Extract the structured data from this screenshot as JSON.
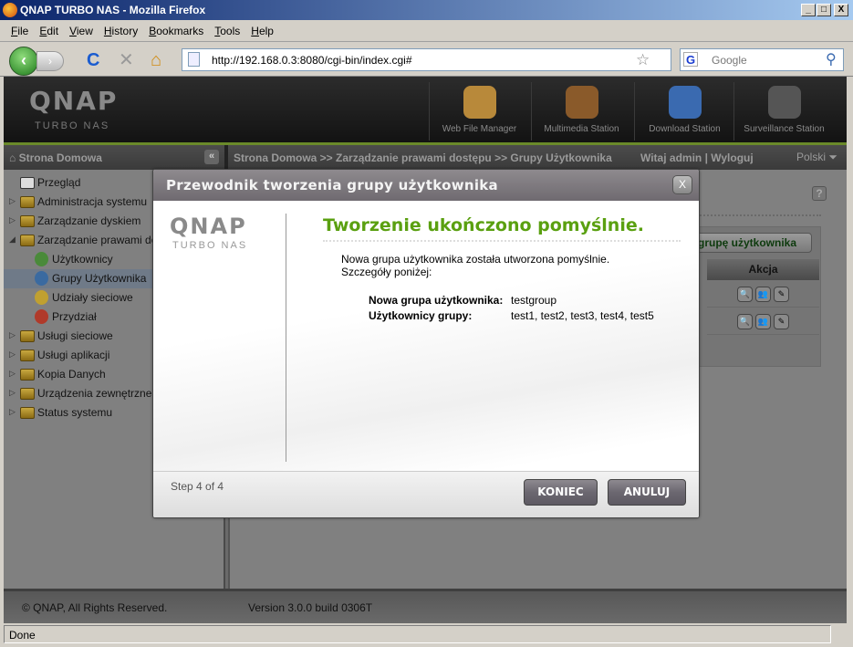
{
  "window": {
    "title": "QNAP TURBO NAS - Mozilla Firefox",
    "minimize": "_",
    "maximize": "□",
    "close": "X"
  },
  "menu": [
    "File",
    "Edit",
    "View",
    "History",
    "Bookmarks",
    "Tools",
    "Help"
  ],
  "nav": {
    "url": "http://192.168.0.3:8080/cgi-bin/index.cgi#",
    "search_placeholder": "Google",
    "back": "‹",
    "forward": "›",
    "reload": "C",
    "stop": "✕",
    "home": "⌂",
    "star": "☆",
    "search_go": "⚲",
    "google_icon": "G"
  },
  "header": {
    "logo": "QNAP",
    "logo_sub": "TURBO NAS",
    "apps": [
      {
        "label": "Web File Manager",
        "color": "#b8893a"
      },
      {
        "label": "Multimedia Station",
        "color": "#8a5a2a"
      },
      {
        "label": "Download Station",
        "color": "#3a6ab0"
      },
      {
        "label": "Surveillance Station",
        "color": "#555555"
      }
    ]
  },
  "crumbbar": {
    "home": "Strona Domowa",
    "collapse": "«",
    "path": "Strona Domowa >> Zarządzanie prawami dostępu >> Grupy Użytkownika",
    "welcome": "Witaj admin | Wyloguj",
    "language": "Polski ⏷"
  },
  "sidebar": {
    "items": [
      {
        "label": "Przegląd",
        "type": "root-noarrow"
      },
      {
        "label": "Administracja systemu",
        "type": "folder"
      },
      {
        "label": "Zarządzanie dyskiem",
        "type": "folder"
      },
      {
        "label": "Zarządzanie prawami dostępu",
        "type": "folder-open"
      },
      {
        "label": "Użytkownicy",
        "type": "sub",
        "icon_color": "#4a8a3a"
      },
      {
        "label": "Grupy Użytkownika",
        "type": "sub",
        "icon_color": "#3a6aa0",
        "selected": true
      },
      {
        "label": "Udziały sieciowe",
        "type": "sub",
        "icon_color": "#c0a030"
      },
      {
        "label": "Przydział",
        "type": "sub",
        "icon_color": "#b03a2a"
      },
      {
        "label": "Usługi sieciowe",
        "type": "folder"
      },
      {
        "label": "Usługi aplikacji",
        "type": "folder"
      },
      {
        "label": "Kopia Danych",
        "type": "folder"
      },
      {
        "label": "Urządzenia zewnętrzne",
        "type": "folder"
      },
      {
        "label": "Status systemu",
        "type": "folder"
      }
    ]
  },
  "content": {
    "help": "?",
    "add_button": "grupę użytkownika",
    "column_action": "Akcja",
    "action_icons": [
      "🔍",
      "👥",
      "✎"
    ]
  },
  "dialog": {
    "title": "Przewodnik tworzenia grupy użytkownika",
    "close": "X",
    "logo": "QNAP",
    "logo_sub": "TURBO NAS",
    "heading": "Tworzenie ukończono pomyślnie.",
    "message1": "Nowa grupa użytkownika została utworzona pomyślnie.",
    "message2": "Szczegóły poniżej:",
    "details": [
      {
        "label": "Nowa grupa użytkownika:",
        "value": "testgroup"
      },
      {
        "label": "Użytkownicy grupy:",
        "value": "test1, test2, test3, test4, test5"
      }
    ],
    "step": "Step 4 of 4",
    "finish": "KONIEC",
    "cancel": "ANULUJ"
  },
  "footer": {
    "copyright": "© QNAP, All Rights Reserved.",
    "version": "Version 3.0.0 build 0306T"
  },
  "status": "Done"
}
